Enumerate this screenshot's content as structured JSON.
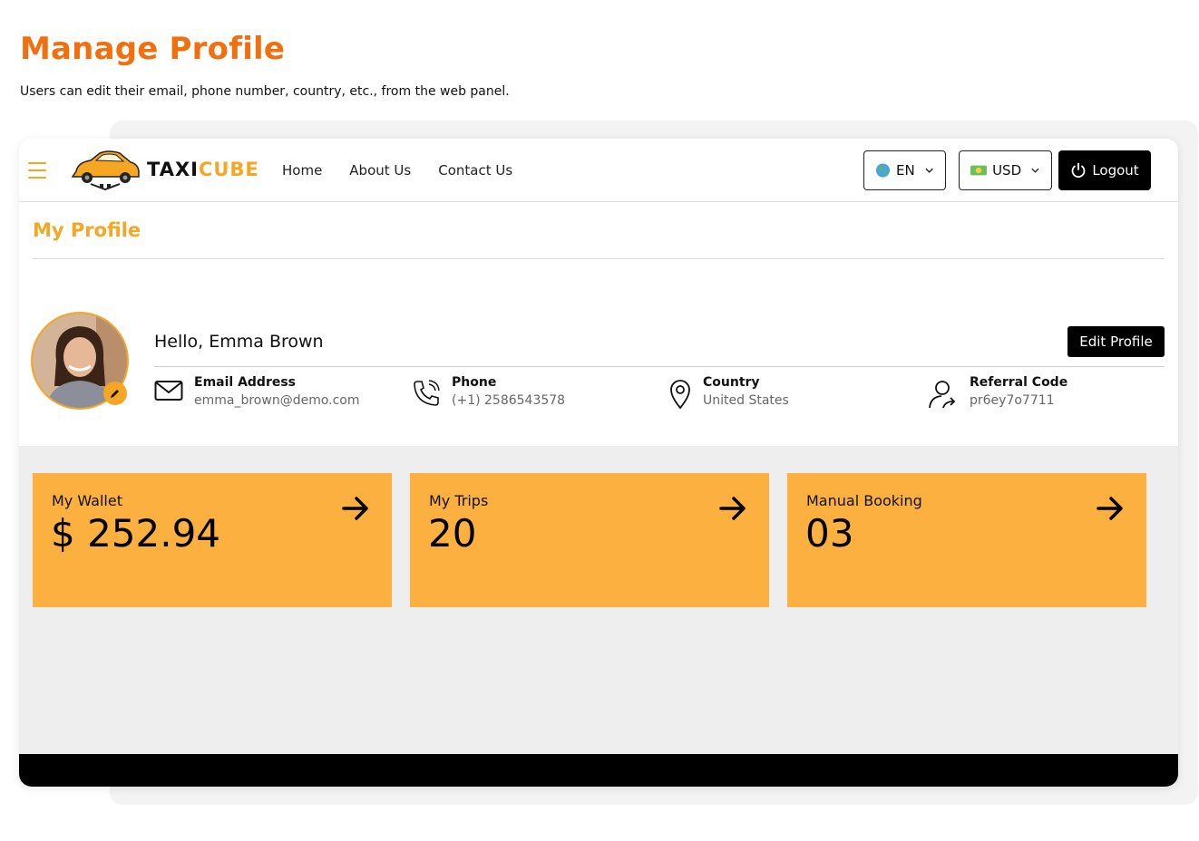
{
  "heading": {
    "title": "Manage Profile",
    "subtitle": "Users can edit their email, phone number, country, etc., from the web panel."
  },
  "navbar": {
    "brand_part1": "TAXI",
    "brand_part2": "CUBE",
    "links": [
      "Home",
      "About Us",
      "Contact Us"
    ],
    "language": "EN",
    "currency": "USD",
    "logout_label": "Logout"
  },
  "profile": {
    "section_title": "My Profile",
    "greeting": "Hello, Emma Brown",
    "edit_label": "Edit Profile",
    "fields": [
      {
        "label": "Email Address",
        "value": "emma_brown@demo.com",
        "icon": "mail-icon"
      },
      {
        "label": "Phone",
        "value": "(+1) 2586543578",
        "icon": "phone-icon"
      },
      {
        "label": "Country",
        "value": "United States",
        "icon": "location-pin-icon"
      },
      {
        "label": "Referral Code",
        "value": "pr6ey7o7711",
        "icon": "user-share-icon"
      }
    ]
  },
  "stats": [
    {
      "label": "My Wallet",
      "value": "$ 252.94"
    },
    {
      "label": "My Trips",
      "value": "20"
    },
    {
      "label": "Manual Booking",
      "value": "03"
    }
  ],
  "colors": {
    "title_orange": "#f26f0f",
    "accent": "#f5a623",
    "card": "#fbb040"
  }
}
